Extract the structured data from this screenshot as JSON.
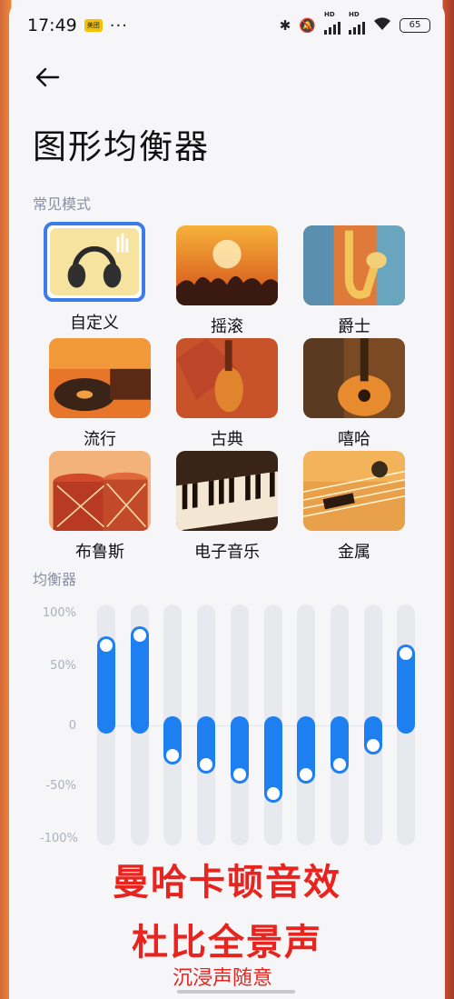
{
  "status": {
    "time": "17:49",
    "app_badge": "美团",
    "more": "···",
    "hd1": "HD",
    "hd2": "HD",
    "battery": "65"
  },
  "header": {
    "back_icon": "arrow-left-icon",
    "title": "图形均衡器"
  },
  "presets_section": {
    "label": "常见模式"
  },
  "presets": [
    {
      "label": "自定义",
      "selected": true,
      "icon": "headphones-icon"
    },
    {
      "label": "摇滚",
      "selected": false,
      "icon": "concert-crowd"
    },
    {
      "label": "爵士",
      "selected": false,
      "icon": "saxophone"
    },
    {
      "label": "流行",
      "selected": false,
      "icon": "turntable"
    },
    {
      "label": "古典",
      "selected": false,
      "icon": "violin"
    },
    {
      "label": "嘻哈",
      "selected": false,
      "icon": "guitar"
    },
    {
      "label": "布鲁斯",
      "selected": false,
      "icon": "drums"
    },
    {
      "label": "电子音乐",
      "selected": false,
      "icon": "keyboard"
    },
    {
      "label": "金属",
      "selected": false,
      "icon": "electric-guitar"
    }
  ],
  "eq_section": {
    "label": "均衡器"
  },
  "eq": {
    "y_labels": [
      "100%",
      "50%",
      "0",
      "-50%",
      "-100%"
    ],
    "bands_percent": [
      73,
      82,
      -28,
      -36,
      -45,
      -63,
      -45,
      -36,
      -19,
      65
    ],
    "accent": "#1e7ff0"
  },
  "overlay": {
    "line1": "曼哈卡顿音效",
    "line2": "杜比全景声",
    "line3": "沉浸声随意"
  }
}
